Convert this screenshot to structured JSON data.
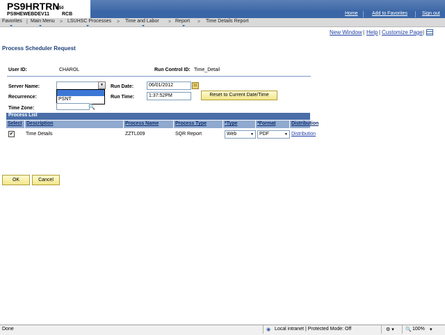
{
  "header": {
    "title": "PS9HRTRN",
    "version": "8.50",
    "subtitle": "PS9HEWEBDEV11",
    "rcb": "RCB",
    "links": [
      "Home",
      "Add to Favorites",
      "Sign out"
    ]
  },
  "menu": {
    "items": [
      "Favorites",
      "Main Menu",
      "LSUHSC Processes",
      "Time and Labor",
      "Report",
      "Time Details Report"
    ]
  },
  "top_links": [
    "New Window",
    "Help",
    "Customize Page"
  ],
  "page_title": "Process Scheduler Request",
  "form": {
    "user_id_label": "User ID:",
    "user_id": "CHAROL",
    "run_control_label": "Run Control ID:",
    "run_control_id": "Time_Detail",
    "server_name_label": "Server Name:",
    "server_name_value": "",
    "server_options": [
      "",
      "PSNT"
    ],
    "run_date_label": "Run Date:",
    "run_date": "06/01/2012",
    "recurrence_label": "Recurrence:",
    "run_time_label": "Run Time:",
    "run_time": "1:37:52PM",
    "reset_button": "Reset to Current Date/Time",
    "time_zone_label": "Time Zone:",
    "time_zone": ""
  },
  "process_list": {
    "title": "Process List",
    "columns": [
      "Select",
      "Description",
      "Process Name",
      "Process Type",
      "*Type",
      "*Format",
      "Distribution"
    ],
    "rows": [
      {
        "selected": "✔",
        "description": "Time Details",
        "process_name": "ZZTL009",
        "process_type": "SQR Report",
        "type": "Web",
        "format": "PDF",
        "distribution": "Distribution"
      }
    ]
  },
  "buttons": {
    "ok": "OK",
    "cancel": "Cancel"
  },
  "status_bar": {
    "left": "Done",
    "zone": "Local intranet | Protected Mode: Off",
    "zoom": "100%"
  }
}
